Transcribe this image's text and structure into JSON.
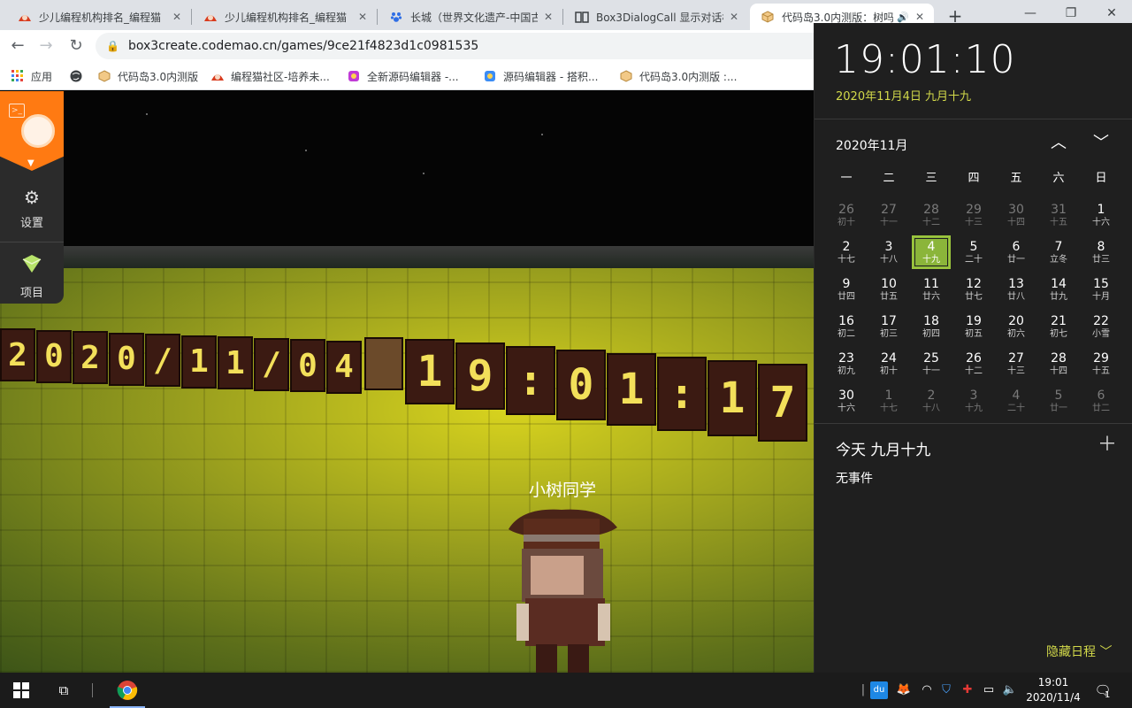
{
  "browser": {
    "tabs": [
      {
        "title": "少儿编程机构排名_编程猫",
        "favicon": "codemao-hat-icon",
        "active": false
      },
      {
        "title": "少儿编程机构排名_编程猫",
        "favicon": "codemao-hat-icon",
        "active": false
      },
      {
        "title": "长城（世界文化遗产-中国古",
        "favicon": "baidu-paw-icon",
        "active": false
      },
      {
        "title": "Box3DialogCall 显示对话框",
        "favicon": "book-icon",
        "active": false
      },
      {
        "title": "代码岛3.0内测版：树吗",
        "favicon": "cube-icon",
        "active": true
      }
    ],
    "url": "box3create.codemao.cn/games/9ce21f4823d1c0981535",
    "bookmarks": [
      {
        "label": "应用",
        "icon": "apps-grid-icon"
      },
      {
        "label": "",
        "icon": "globe-icon"
      },
      {
        "label": "代码岛3.0内测版",
        "icon": "cube-icon"
      },
      {
        "label": "编程猫社区-培养未...",
        "icon": "codemao-hat-icon"
      },
      {
        "label": "全新源码编辑器 -...",
        "icon": "editor-icon"
      },
      {
        "label": "源码编辑器 - 搭积...",
        "icon": "editor-blocks-icon"
      },
      {
        "label": "代码岛3.0内测版 :...",
        "icon": "cube-icon"
      }
    ]
  },
  "sidebar": {
    "items": [
      {
        "label": "设置",
        "icon": "gear-icon"
      },
      {
        "label": "项目",
        "icon": "project-icon"
      }
    ]
  },
  "game": {
    "date_blocks": [
      "2",
      "0",
      "2",
      "0",
      "/",
      "1",
      "1",
      "/",
      "0",
      "4"
    ],
    "time_blocks": [
      "1",
      "9",
      ":",
      "0",
      "1",
      ":",
      "1",
      "7"
    ],
    "player_name": "小树同学"
  },
  "flyout": {
    "time": "19:01:10",
    "date": "2020年11月4日 九月十九",
    "month": "2020年11月",
    "weekdays": [
      "一",
      "二",
      "三",
      "四",
      "五",
      "六",
      "日"
    ],
    "days": [
      {
        "n": "26",
        "l": "初十",
        "dim": true
      },
      {
        "n": "27",
        "l": "十一",
        "dim": true
      },
      {
        "n": "28",
        "l": "十二",
        "dim": true
      },
      {
        "n": "29",
        "l": "十三",
        "dim": true
      },
      {
        "n": "30",
        "l": "十四",
        "dim": true
      },
      {
        "n": "31",
        "l": "十五",
        "dim": true
      },
      {
        "n": "1",
        "l": "十六",
        "dim": false
      },
      {
        "n": "2",
        "l": "十七",
        "dim": false
      },
      {
        "n": "3",
        "l": "十八",
        "dim": false
      },
      {
        "n": "4",
        "l": "十九",
        "dim": false,
        "today": true
      },
      {
        "n": "5",
        "l": "二十",
        "dim": false
      },
      {
        "n": "6",
        "l": "廿一",
        "dim": false
      },
      {
        "n": "7",
        "l": "立冬",
        "dim": false
      },
      {
        "n": "8",
        "l": "廿三",
        "dim": false
      },
      {
        "n": "9",
        "l": "廿四",
        "dim": false
      },
      {
        "n": "10",
        "l": "廿五",
        "dim": false
      },
      {
        "n": "11",
        "l": "廿六",
        "dim": false
      },
      {
        "n": "12",
        "l": "廿七",
        "dim": false
      },
      {
        "n": "13",
        "l": "廿八",
        "dim": false
      },
      {
        "n": "14",
        "l": "廿九",
        "dim": false
      },
      {
        "n": "15",
        "l": "十月",
        "dim": false
      },
      {
        "n": "16",
        "l": "初二",
        "dim": false
      },
      {
        "n": "17",
        "l": "初三",
        "dim": false
      },
      {
        "n": "18",
        "l": "初四",
        "dim": false
      },
      {
        "n": "19",
        "l": "初五",
        "dim": false
      },
      {
        "n": "20",
        "l": "初六",
        "dim": false
      },
      {
        "n": "21",
        "l": "初七",
        "dim": false
      },
      {
        "n": "22",
        "l": "小雪",
        "dim": false
      },
      {
        "n": "23",
        "l": "初九",
        "dim": false
      },
      {
        "n": "24",
        "l": "初十",
        "dim": false
      },
      {
        "n": "25",
        "l": "十一",
        "dim": false
      },
      {
        "n": "26",
        "l": "十二",
        "dim": false
      },
      {
        "n": "27",
        "l": "十三",
        "dim": false
      },
      {
        "n": "28",
        "l": "十四",
        "dim": false
      },
      {
        "n": "29",
        "l": "十五",
        "dim": false
      },
      {
        "n": "30",
        "l": "十六",
        "dim": false
      },
      {
        "n": "1",
        "l": "十七",
        "dim": true
      },
      {
        "n": "2",
        "l": "十八",
        "dim": true
      },
      {
        "n": "3",
        "l": "十九",
        "dim": true
      },
      {
        "n": "4",
        "l": "二十",
        "dim": true
      },
      {
        "n": "5",
        "l": "廿一",
        "dim": true
      },
      {
        "n": "6",
        "l": "廿二",
        "dim": true
      }
    ],
    "agenda_title": "今天 九月十九",
    "agenda_empty": "无事件",
    "hide_agenda": "隐藏日程"
  },
  "taskbar": {
    "clock_time": "19:01",
    "clock_date": "2020/11/4",
    "notification_count": "1",
    "tray_icons": [
      "baidu-du-icon",
      "fox-icon",
      "wifi-icon",
      "shield-icon",
      "security-icon",
      "battery-icon",
      "volume-icon"
    ]
  },
  "colors": {
    "accent": "#9bc53d",
    "accent_text": "#d2d94a",
    "brand_orange": "#ff7a12",
    "flyout_bg": "#1f1f1f",
    "taskbar_bg": "#1b1b1b"
  }
}
